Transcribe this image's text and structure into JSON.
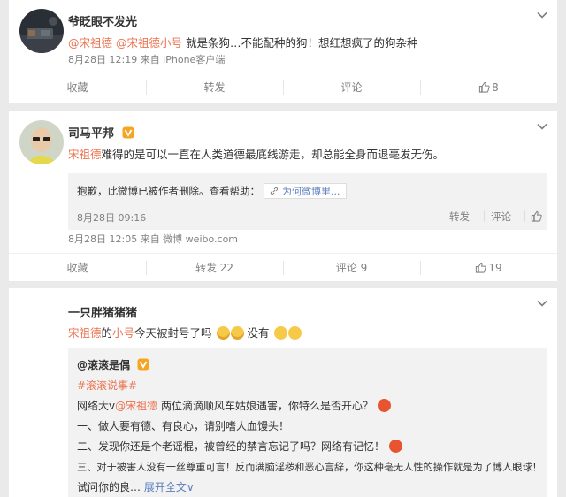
{
  "post1": {
    "author": "爷眨眼不发光",
    "mention1": "@宋祖德",
    "mention2": "@宋祖德小号",
    "text": " 就是条狗…不能配种的狗！想红想疯了的狗杂种",
    "meta": "8月28日 12:19 来自 iPhone客户端",
    "actions": {
      "favorite": "收藏",
      "repost": "转发",
      "comment": "评论",
      "like": "8"
    }
  },
  "post2": {
    "author": "司马平邦",
    "mention": "宋祖德",
    "text": "难得的是可以一直在人类道德最底线游走，却总能全身而退毫发无伤。",
    "quote": {
      "deleted": "抱歉，此微博已被作者删除。查看帮助：",
      "help_link": "为何微博里...",
      "time": "8月28日 09:16",
      "repost": "转发",
      "comment": "评论"
    },
    "meta": "8月28日 12:05 来自 微博 weibo.com",
    "actions": {
      "favorite": "收藏",
      "repost": "转发 22",
      "comment": "评论 9",
      "like": "19"
    }
  },
  "post3": {
    "author": "一只胖猪猪猪",
    "mention": "宋祖德",
    "text_a": "的",
    "mention_b": "小号",
    "text_b": "今天被封号了吗",
    "text_c": " 没有",
    "quote": {
      "author": "@滚滚是偶",
      "topic": "#滚滚说事#",
      "line1_a": "网络大v",
      "line1_mention": "@宋祖德",
      "line1_b": " 两位滴滴顺风车姑娘遇害，你特么是否开心？",
      "line2": "一、做人要有德、有良心，请别嗜人血馒头！",
      "line3": "二、发现你还是个老谣棍，被曾经的禁言忘记了吗？网络有记忆！",
      "line4": "三、对于被害人没有一丝尊重可言！反而满脑淫秽和恶心言辞，你这种毫无人性的操作就是为了博人眼球！",
      "line5": "试问你的良…",
      "expand": "展开全文",
      "expand_arrow": "∨"
    }
  },
  "colors": {
    "link": "#eb7350",
    "blue_link": "#5d7fbd",
    "meta": "#808080",
    "quote_bg": "#f2f2f2"
  },
  "icons": [
    "chevron-down-icon",
    "thumb-up-icon",
    "verified-badge-icon",
    "emoji-icon",
    "link-icon"
  ]
}
